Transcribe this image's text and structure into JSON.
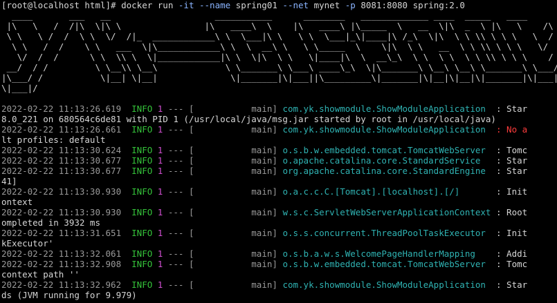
{
  "prompt": {
    "user_host": "[root@localhost html]# ",
    "command": "docker run ",
    "flag_it": "-it",
    "name_flag": " --name",
    "name_val": " spring01 ",
    "net_flag": "--net",
    "net_val": " mynet ",
    "p_flag": "-p",
    "p_val": " 8081:8080 spring:2.0"
  },
  "banner": [
    "  ____       ___   __                    ___________      ________   _____________ ____  _____   ____      ____",
    " |\\   \\   /  /|\\  \\|\\ \\                |\\   ____\\  \\    |\\   ____\\ |\\_____  \\   __  \\|\\  _  \\ |\\   \\    /\\   \\",
    " \\ \\   \\ /  /  \\ \\  \\/  /|_  ____________\\ \\  \\___|\\ \\   \\ \\  \\___|_\\|____|\\ /_\\  \\|\\  \\ \\ \\\\ \\ \\ \\   \\  /  \\   \\",
    "  \\ \\   /  /    \\ \\   ___  \\|\\____________\\ \\  \\  __\\ \\   \\ \\_____  \\    \\|\\  \\ \\   __  \\ \\ \\\\ \\ \\ \\   \\/  /\\   \\",
    "   \\/  /  /      \\ \\  \\\\ \\  \\|____________|\\ \\  \\|\\  \\ \\   \\|____|\\  \\  __\\_\\  \\ \\  \\ \\  \\ \\ \\\\ \\ \\ \\    /  \\ \\   \\",
    " __/  / /         \\ \\__\\\\ \\__\\             \\ \\_______\\ \\___\\ ____\\_\\  \\|\\_______\\ \\__\\ \\__\\ \\_______\\ \\___/    \\ \\___\\",
    "|\\___/ /           \\|__| \\|__|              \\|_______|\\|___||\\_________\\|_______|\\|__|\\|__|\\|_______|\\|___|     \\|___|",
    "\\|___|/"
  ],
  "log_lines": [
    {
      "time": "2022-02-22 11:13:26.619",
      "level": "INFO",
      "pid": "1",
      "sep": " --- [",
      "thread": "           main]",
      "logger": "com.yk.showmodule.ShowModuleApplication",
      "tail": "  : Star",
      "tail_class": "c-text"
    },
    {
      "text": "8.0_221 on 680564c6de81 with PID 1 (/usr/local/java/msg.jar started by root in /usr/local/java)"
    },
    {
      "time": "2022-02-22 11:13:26.661",
      "level": "INFO",
      "pid": "1",
      "sep": " --- [",
      "thread": "           main]",
      "logger": "com.yk.showmodule.ShowModuleApplication",
      "tail": "  : No a",
      "tail_class": "c-warn"
    },
    {
      "text": "lt profiles: default"
    },
    {
      "time": "2022-02-22 11:13:30.624",
      "level": "INFO",
      "pid": "1",
      "sep": " --- [",
      "thread": "           main]",
      "logger": "o.s.b.w.embedded.tomcat.TomcatWebServer",
      "tail": "  : Tomc",
      "tail_class": "c-text"
    },
    {
      "time": "2022-02-22 11:13:30.677",
      "level": "INFO",
      "pid": "1",
      "sep": " --- [",
      "thread": "           main]",
      "logger": "o.apache.catalina.core.StandardService",
      "tail": "   : Star",
      "tail_class": "c-text"
    },
    {
      "time": "2022-02-22 11:13:30.677",
      "level": "INFO",
      "pid": "1",
      "sep": " --- [",
      "thread": "           main]",
      "logger": "org.apache.catalina.core.StandardEngine",
      "tail": "  : Star",
      "tail_class": "c-text"
    },
    {
      "text": "41]"
    },
    {
      "time": "2022-02-22 11:13:30.930",
      "level": "INFO",
      "pid": "1",
      "sep": " --- [",
      "thread": "           main]",
      "logger": "o.a.c.c.C.[Tomcat].[localhost].[/]",
      "tail": "       : Init",
      "tail_class": "c-text"
    },
    {
      "text": "ontext"
    },
    {
      "time": "2022-02-22 11:13:30.930",
      "level": "INFO",
      "pid": "1",
      "sep": " --- [",
      "thread": "           main]",
      "logger": "w.s.c.ServletWebServerApplicationContext",
      "tail": " : Root",
      "tail_class": "c-text"
    },
    {
      "text": "ompleted in 3932 ms"
    },
    {
      "time": "2022-02-22 11:13:31.651",
      "level": "INFO",
      "pid": "1",
      "sep": " --- [",
      "thread": "           main]",
      "logger": "o.s.s.concurrent.ThreadPoolTaskExecutor",
      "tail": "  : Init",
      "tail_class": "c-text"
    },
    {
      "text": "kExecutor'"
    },
    {
      "time": "2022-02-22 11:13:32.061",
      "level": "INFO",
      "pid": "1",
      "sep": " --- [",
      "thread": "           main]",
      "logger": "o.s.b.a.w.s.WelcomePageHandlerMapping",
      "tail": "    : Addi",
      "tail_class": "c-text"
    },
    {
      "time": "2022-02-22 11:13:32.908",
      "level": "INFO",
      "pid": "1",
      "sep": " --- [",
      "thread": "           main]",
      "logger": "o.s.b.w.embedded.tomcat.TomcatWebServer",
      "tail": "  : Tomc",
      "tail_class": "c-text"
    },
    {
      "text": "context path ''"
    },
    {
      "time": "2022-02-22 11:13:32.962",
      "level": "INFO",
      "pid": "1",
      "sep": " --- [",
      "thread": "           main]",
      "logger": "com.yk.showmodule.ShowModuleApplication",
      "tail": "  : Star",
      "tail_class": "c-text"
    },
    {
      "text": "ds (JVM running for 9.979)"
    }
  ]
}
